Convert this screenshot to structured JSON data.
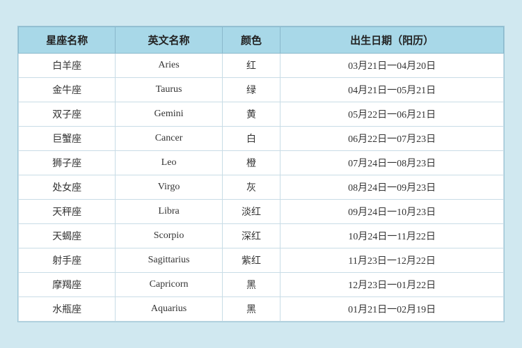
{
  "table": {
    "headers": [
      "星座名称",
      "英文名称",
      "颜色",
      "出生日期（阳历）"
    ],
    "rows": [
      {
        "chinese": "白羊座",
        "english": "Aries",
        "color": "红",
        "date": "03月21日一04月20日"
      },
      {
        "chinese": "金牛座",
        "english": "Taurus",
        "color": "绿",
        "date": "04月21日一05月21日"
      },
      {
        "chinese": "双子座",
        "english": "Gemini",
        "color": "黄",
        "date": "05月22日一06月21日"
      },
      {
        "chinese": "巨蟹座",
        "english": "Cancer",
        "color": "白",
        "date": "06月22日一07月23日"
      },
      {
        "chinese": "狮子座",
        "english": "Leo",
        "color": "橙",
        "date": "07月24日一08月23日"
      },
      {
        "chinese": "处女座",
        "english": "Virgo",
        "color": "灰",
        "date": "08月24日一09月23日"
      },
      {
        "chinese": "天秤座",
        "english": "Libra",
        "color": "淡红",
        "date": "09月24日一10月23日"
      },
      {
        "chinese": "天蝎座",
        "english": "Scorpio",
        "color": "深红",
        "date": "10月24日一11月22日"
      },
      {
        "chinese": "射手座",
        "english": "Sagittarius",
        "color": "紫红",
        "date": "11月23日一12月22日"
      },
      {
        "chinese": "摩羯座",
        "english": "Capricorn",
        "color": "黑",
        "date": "12月23日一01月22日"
      },
      {
        "chinese": "水瓶座",
        "english": "Aquarius",
        "color": "黑",
        "date": "01月21日一02月19日"
      }
    ]
  }
}
